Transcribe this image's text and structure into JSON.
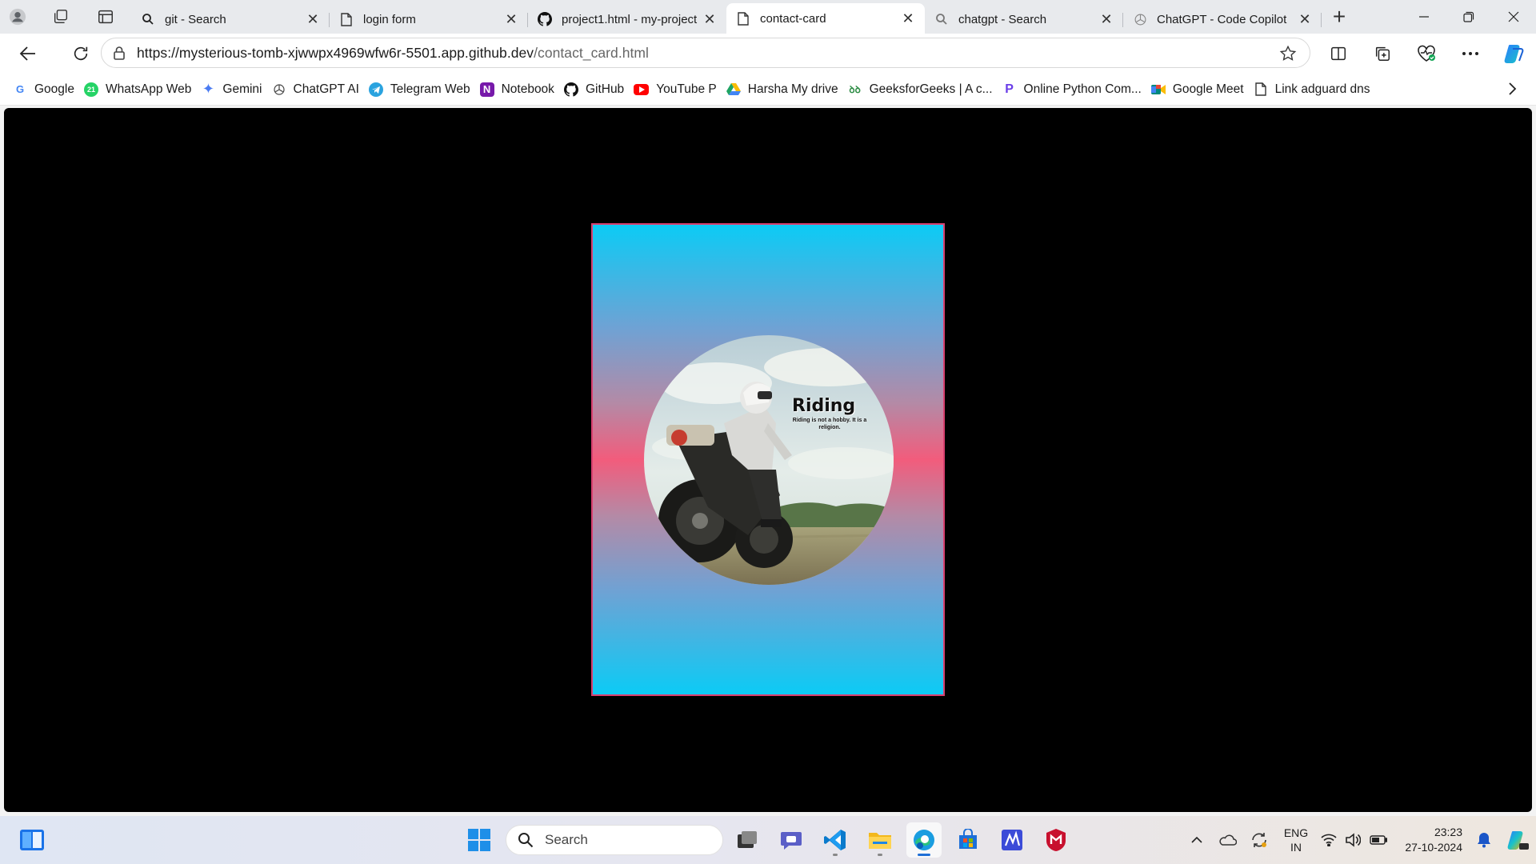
{
  "tabs": [
    {
      "title": "git - Search",
      "favicon": "search-icon"
    },
    {
      "title": "login form",
      "favicon": "page-icon"
    },
    {
      "title": "project1.html - my-project",
      "favicon": "github-icon"
    },
    {
      "title": "contact-card",
      "favicon": "page-icon",
      "active": true
    },
    {
      "title": "chatgpt - Search",
      "favicon": "search-icon"
    },
    {
      "title": "ChatGPT - Code Copilot",
      "favicon": "chatgpt-icon"
    }
  ],
  "address": {
    "host": "https://mysterious-tomb-xjwwpx4969wfw6r-5501.app.github.dev",
    "path": "/contact_card.html"
  },
  "bookmarks": [
    {
      "label": "Google",
      "icon": "google-icon",
      "color": "#4285f4"
    },
    {
      "label": "WhatsApp Web",
      "icon": "whatsapp-icon",
      "color": "#25d366"
    },
    {
      "label": "Gemini",
      "icon": "gemini-icon",
      "color": "#4a7bf2"
    },
    {
      "label": "ChatGPT AI",
      "icon": "chatgpt-icon",
      "color": "#555555"
    },
    {
      "label": "Telegram Web",
      "icon": "telegram-icon",
      "color": "#2aa3df"
    },
    {
      "label": "Notebook",
      "icon": "onenote-icon",
      "color": "#7719aa"
    },
    {
      "label": "GitHub",
      "icon": "github-icon",
      "color": "#111111"
    },
    {
      "label": "YouTube P",
      "icon": "youtube-icon",
      "color": "#ff0000"
    },
    {
      "label": "Harsha My drive",
      "icon": "drive-icon",
      "color": "#1fa463"
    },
    {
      "label": "GeeksforGeeks | A c...",
      "icon": "gfg-icon",
      "color": "#2f8d46"
    },
    {
      "label": "Online Python Com...",
      "icon": "python-icon",
      "color": "#6a3de8"
    },
    {
      "label": "Google Meet",
      "icon": "meet-icon",
      "color": "#00897b"
    },
    {
      "label": "Link adguard dns",
      "icon": "page-icon",
      "color": "#333333"
    }
  ],
  "card": {
    "image_caption_title": "Riding",
    "image_caption_sub": "Riding is not a hobby. It is a religion.",
    "colors": {
      "edge": "#0ccbf5",
      "center": "#f25c7c",
      "border": "#d84070"
    }
  },
  "taskbar": {
    "search_placeholder": "Search",
    "apps": [
      "start-icon",
      "task-view-icon",
      "teams-icon",
      "vscode-icon",
      "file-explorer-icon",
      "edge-icon",
      "store-icon",
      "pen-app-icon",
      "mcafee-icon"
    ],
    "lang_top": "ENG",
    "lang_bottom": "IN",
    "time": "23:23",
    "date": "27-10-2024"
  }
}
